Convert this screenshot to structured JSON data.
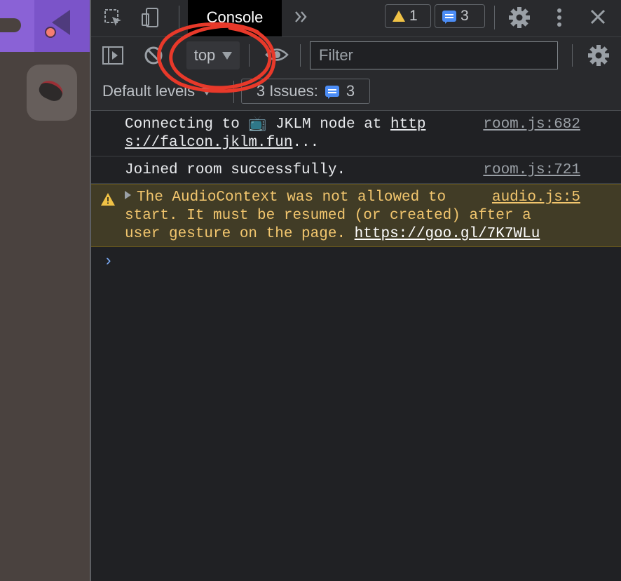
{
  "tabs": {
    "console_label": "Console"
  },
  "badges": {
    "warnings_count": "1",
    "messages_count": "3"
  },
  "toolbar": {
    "context_value": "top",
    "filter_placeholder": "Filter",
    "levels_label": "Default levels",
    "issues_label": "3 Issues:",
    "issues_count": "3"
  },
  "logs": [
    {
      "line1_prefix": "Connecting to 📺 JKLM node at ",
      "line1_link": "http",
      "line2_link": "s://falcon.jklm.fun",
      "line2_suffix": "...",
      "source": "room.js:682"
    },
    {
      "text": "Joined room successfully.",
      "source": "room.js:721"
    },
    {
      "line1": "The AudioContext was not allowed to",
      "line2": "start. It must be resumed (or created) after a",
      "line3_prefix": "user gesture on the page. ",
      "line3_link": "https://goo.gl/7K7WLu",
      "source": "audio.js:5"
    }
  ],
  "prompt_symbol": "›",
  "colors": {
    "accent_purple": "#8a62d6",
    "warning_bg": "#413c26",
    "warning_text": "#f2c66e",
    "annotation_red": "#e8392a",
    "info_blue": "#4c8df6"
  },
  "icons": [
    "inspect-element-icon",
    "device-toolbar-icon",
    "more-tabs-icon",
    "warning-icon",
    "message-icon",
    "settings-icon",
    "kebab-menu-icon",
    "close-icon",
    "sidebar-toggle-icon",
    "clear-console-icon",
    "eye-icon",
    "chevron-prompt-icon"
  ]
}
